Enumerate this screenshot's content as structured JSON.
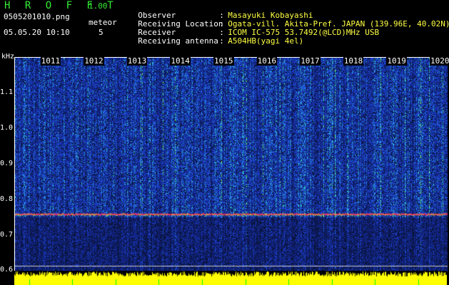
{
  "header": {
    "app_title": "H R O F F T",
    "version": "1.00",
    "filename": "0505201010.png",
    "datetime": "05.05.20 10:10",
    "meteor_label": "meteor",
    "meteor_count": "5"
  },
  "info": [
    {
      "label": "Observer",
      "sep": ":",
      "value": "Masayuki Kobayashi"
    },
    {
      "label": "Receiving Location",
      "sep": ":",
      "value": "Ogata-vill. Akita-Pref. JAPAN (139.96E, 40.02N)"
    },
    {
      "label": "Receiver",
      "sep": ":",
      "value": "ICOM IC-575 53.7492(@LCD)MHz USB"
    },
    {
      "label": "Receiving antenna",
      "sep": ":",
      "value": "A504HB(yagi 4el)"
    }
  ],
  "axis": {
    "unit": "kHz",
    "y_ticks": [
      "1.1",
      "1.0",
      "0.9",
      "0.8",
      "0.7",
      "0.6"
    ],
    "y_range": [
      0.6,
      1.2
    ],
    "minute_labels": [
      "1011",
      "1012",
      "1013",
      "1014",
      "1015",
      "1016",
      "1017",
      "1018",
      "1019",
      "1020"
    ]
  },
  "signal": {
    "carrier_khz": 0.76
  },
  "colors": {
    "background": "#000000",
    "label_green": "#33ee33",
    "value_yellow": "#ffff44",
    "spectrum_blue": "#1a2a9a",
    "carrier_red": "#ff3060",
    "noise_bar": "#ffff00"
  }
}
